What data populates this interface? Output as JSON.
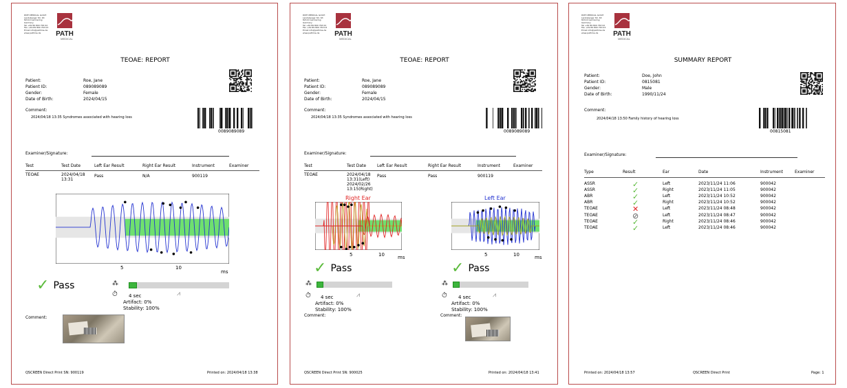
{
  "address_lines": [
    "PATH MEDICAL GmbH",
    "Landsberger Str. 63",
    "82110 Germering",
    "Germany",
    "Tel +49 89 800 763 02",
    "Fax +49 89 800 763 03",
    "Email info@pathme.de",
    "www.pathme.de"
  ],
  "logo": {
    "name": "PATH",
    "sub": "MEDICAL"
  },
  "labels": {
    "patient": "Patient:",
    "patient_id": "Patient ID:",
    "gender": "Gender:",
    "dob": "Date of Birth:",
    "comment": "Comment:",
    "examiner_signature": "Examiner/Signature:",
    "ms": "ms"
  },
  "report1": {
    "title": "TEOAE: REPORT",
    "patient": "Roe, Jane",
    "patient_id": "089089089",
    "gender": "Female",
    "dob": "2024/04/15",
    "comment": "2024/04/18 13:35  Syndromes associated with hearing loss",
    "barcode": "0089089089",
    "headers": [
      "Test",
      "Test Date",
      "Left Ear Result",
      "Right Ear Result",
      "Instrument",
      "Examiner"
    ],
    "row": {
      "test": "TEOAE",
      "date1": "2024/04/18",
      "date2": "13:31",
      "left": "Pass",
      "right": "N/A",
      "instrument": "900119"
    },
    "ticks": [
      "5",
      "10"
    ],
    "pass": "Pass",
    "time": "4 sec",
    "artifact": "Artifact: 0%",
    "stability": "Stability: 100%",
    "progress": 0.08,
    "footer_left": "QSCREEN Direct Print SN: 900119",
    "footer_right": "Printed on: 2024/04/18 13:38"
  },
  "report2": {
    "title": "TEOAE: REPORT",
    "patient": "Roe, Jane",
    "patient_id": "089089089",
    "gender": "Female",
    "dob": "2024/04/15",
    "comment": "2024/04/18 13:35  Syndromes associated with hearing loss",
    "barcode": "0089089089",
    "headers": [
      "Test",
      "Test Date",
      "Left Ear Result",
      "Right Ear Result",
      "Instrument",
      "Examiner"
    ],
    "row": {
      "test": "TEOAE",
      "date1": "2024/04/18",
      "date2": "13:31(Left)",
      "date3": "2024/02/26",
      "date4": "13:15(Right)",
      "left": "Pass",
      "right": "Pass",
      "instrument": "900119"
    },
    "right_ear": "Right Ear",
    "left_ear": "Left Ear",
    "ticks": [
      "5",
      "10"
    ],
    "pass": "Pass",
    "time": "4 sec",
    "artifact": "Artifact: 0%",
    "stability": "Stability: 100%",
    "progress": 0.09,
    "footer_left": "QSCREEN Direct Print SN: 900025",
    "footer_right": "Printed on: 2024/04/18 13:41"
  },
  "report3": {
    "title": "SUMMARY REPORT",
    "patient": "Doe, John",
    "patient_id": "0815081",
    "gender": "Male",
    "dob": "1990/11/24",
    "comment": "2024/04/18 13:50  Family history of hearing loss",
    "barcode": "00815081",
    "headers": [
      "Type",
      "Result",
      "Ear",
      "Date",
      "Instrument",
      "Examiner"
    ],
    "rows": [
      {
        "type": "ASSR",
        "result": "pass",
        "ear": "Left",
        "date": "2023/11/24 11:06",
        "instrument": "900042"
      },
      {
        "type": "ASSR",
        "result": "pass",
        "ear": "Right",
        "date": "2023/11/24 11:05",
        "instrument": "900042"
      },
      {
        "type": "ABR",
        "result": "pass",
        "ear": "Left",
        "date": "2023/11/24 10:52",
        "instrument": "900042"
      },
      {
        "type": "ABR",
        "result": "pass",
        "ear": "Right",
        "date": "2023/11/24 10:52",
        "instrument": "900042"
      },
      {
        "type": "TEOAE",
        "result": "refer",
        "ear": "Left",
        "date": "2023/11/24 08:48",
        "instrument": "900042"
      },
      {
        "type": "TEOAE",
        "result": "incomplete",
        "ear": "Left",
        "date": "2023/11/24 08:47",
        "instrument": "900042"
      },
      {
        "type": "TEOAE",
        "result": "pass",
        "ear": "Right",
        "date": "2023/11/24 08:46",
        "instrument": "900042"
      },
      {
        "type": "TEOAE",
        "result": "pass",
        "ear": "Left",
        "date": "2023/11/24 08:46",
        "instrument": "900042"
      }
    ],
    "footer_left": "Printed on: 2024/04/18 13:57",
    "footer_mid": "QSCREEN Direct Print",
    "footer_right": "Page: 1"
  },
  "colors": {
    "pass": "#5aba3a",
    "refer": "#e02020",
    "border": "#b84a4a",
    "logo": "#a8323e",
    "right_ear": "#e02020",
    "left_ear": "#2030d0",
    "wave_band": "#6fe06f"
  }
}
